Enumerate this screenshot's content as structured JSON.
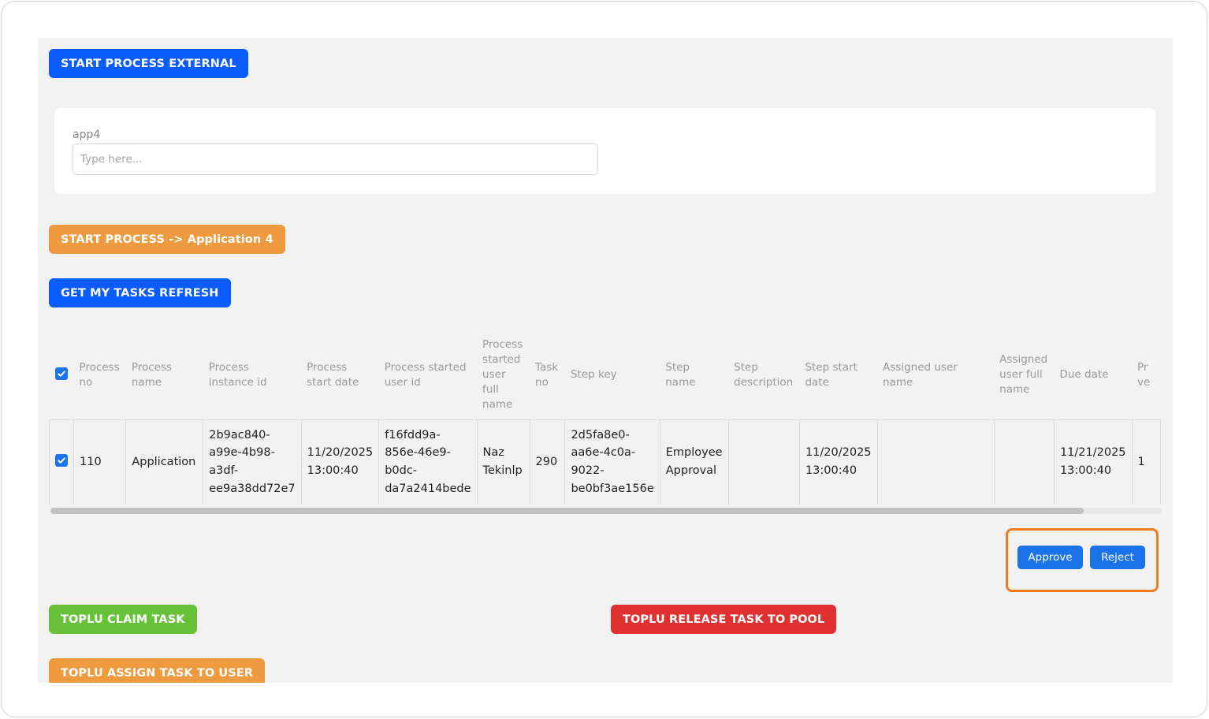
{
  "buttons": {
    "start_external": "START PROCESS EXTERNAL",
    "start_process_app4": "START PROCESS -> Application 4",
    "get_tasks_refresh": "GET MY TASKS REFRESH",
    "toplu_claim": "TOPLU CLAIM TASK",
    "toplu_release": "TOPLU RELEASE TASK TO POOL",
    "toplu_assign": "TOPLU ASSIGN TASK TO USER",
    "approve": "Approve",
    "reject": "Reject"
  },
  "form": {
    "label": "app4",
    "placeholder": "Type here..."
  },
  "table": {
    "headers": [
      "Process no",
      "Process name",
      "Process instance id",
      "Process start date",
      "Process started user id",
      "Process started user full name",
      "Task no",
      "Step key",
      "Step name",
      "Step description",
      "Step start date",
      "Assigned user name",
      "Assigned user full name",
      "Due date",
      "Pr ve"
    ],
    "rows": [
      {
        "checked": true,
        "cells": [
          "110",
          "Application",
          "2b9ac840-a99e-4b98-a3df-ee9a38dd72e7",
          "11/20/2025 13:00:40",
          "f16fdd9a-856e-46e9-b0dc-da7a2414bede",
          "Naz Tekinlp",
          "290",
          "2d5fa8e0-aa6e-4c0a-9022-be0bf3ae156e",
          "Employee Approval",
          "",
          "11/20/2025 13:00:40",
          "",
          "",
          "11/21/2025 13:00:40",
          "1"
        ]
      }
    ]
  },
  "colors": {
    "primary_blue": "#0a5cff",
    "orange": "#ee9a3e",
    "green": "#67c23a",
    "red": "#e03131",
    "highlight_border": "#f07c1e",
    "checkbox_blue": "#1a73e8"
  },
  "icons": {
    "header_checkbox": "checkbox-checked-icon",
    "row_checkbox": "checkbox-checked-icon"
  }
}
